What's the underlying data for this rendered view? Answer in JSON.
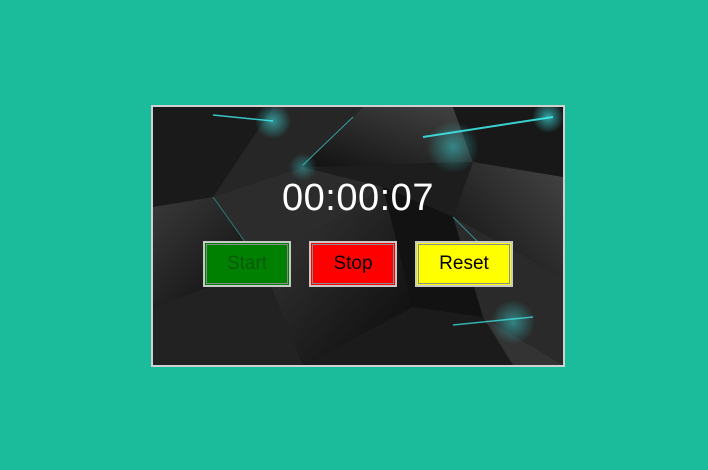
{
  "stopwatch": {
    "time": "00:00:07",
    "buttons": {
      "start_label": "Start",
      "stop_label": "Stop",
      "reset_label": "Reset"
    }
  },
  "colors": {
    "page_background": "#1abc9c",
    "start": "#008000",
    "stop": "#ff0000",
    "reset": "#ffff00",
    "accent_glow": "#2ee6e6"
  }
}
